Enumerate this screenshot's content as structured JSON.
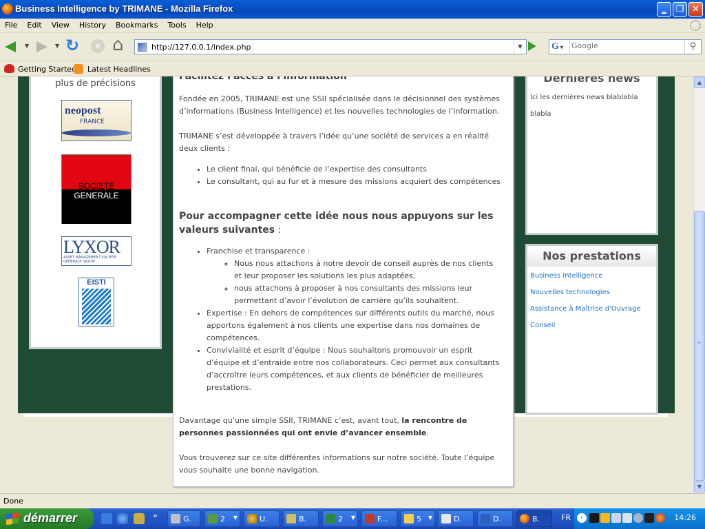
{
  "window": {
    "title": "Business Intelligence by TRIMANE - Mozilla Firefox"
  },
  "menu": [
    "File",
    "Edit",
    "View",
    "History",
    "Bookmarks",
    "Tools",
    "Help"
  ],
  "nav": {
    "url": "http://127.0.0.1/index.php",
    "search_placeholder": "Google",
    "search_engine_letter": "G"
  },
  "bookmarks": [
    "Getting Started",
    "Latest Headlines"
  ],
  "page": {
    "left": {
      "precisions": "plus de précisions",
      "logos": [
        "neopost",
        "FRANCE",
        "SOCIETE",
        "GENERALE",
        "LYXOR",
        "ASSET MANAGEMENT SOCIETE GENERALE GROUP",
        "EISTI"
      ]
    },
    "main": {
      "cut_heading": "Facilitez l'accès à l'information",
      "p1": "Fondée en 2005, TRIMANE est une SSII spécialisée dans le décisionnel des systèmes d’informations (Business Intelligence) et les nouvelles technologies de l’information.",
      "p2": "TRIMANE s’est développée à travers l’idée qu’une société de services a en réalité deux clients :",
      "clients": [
        "Le client final, qui bénéficie de l’expertise des consultants",
        "Le consultant, qui au fur et à mesure des missions acquiert des compétences"
      ],
      "h2": "Pour accompagner cette idée nous nous appuyons sur les valeurs suivantes",
      "h2_colon": " :",
      "v1": "Franchise et transparence :",
      "v1_sub": [
        "Nous nous attachons à notre devoir de conseil auprès de nos clients et leur proposer les solutions les plus adaptées,",
        "nous attachons à proposer à nos consultants des missions leur permettant d’avoir l’évolution de carrière qu’ils souhaitent."
      ],
      "v2": "Expertise : En dehors de compétences sur différents outils du marché, nous apportons également à nos clients une expertise dans nos domaines de compétences.",
      "v3": "Convivialité et esprit d’équipe : Nous souhaitons promouvoir un esprit d’équipe et d’entraide entre nos collaborateurs. Ceci permet aux consultants d’accroître leurs compétences, et aux clients de bénéficier de meilleures prestations.",
      "p3_a": "Davantage qu’une simple SSII, TRIMANE c’est, avant tout, ",
      "p3_b": "la rencontre de personnes passionnées qui ont envie d’avancer ensemble",
      "p3_c": ".",
      "p4": "Vous trouverez sur ce site différentes informations sur notre société. Toute l’équipe vous souhaite une bonne navigation."
    },
    "news": {
      "title": "Dernières news",
      "text": "Ici les dernières news blablabla blabla"
    },
    "prestations": {
      "title": "Nos prestations",
      "links": [
        "Business Intelligence",
        "Nouvelles technologies",
        "Assistance à Maîtrise d'Ouvrage",
        "Conseil"
      ]
    }
  },
  "status": "Done",
  "taskbar": {
    "start": "démarrer",
    "buttons": [
      "G.",
      "2",
      "U.",
      "B.",
      "2",
      "F...",
      "5",
      "D.",
      "D.",
      "B."
    ],
    "lang": "FR",
    "clock": "14:26"
  },
  "colors": {
    "green_bg": "#1f4a33",
    "link": "#1e6ec8",
    "xp_blue": "#2459c9"
  }
}
